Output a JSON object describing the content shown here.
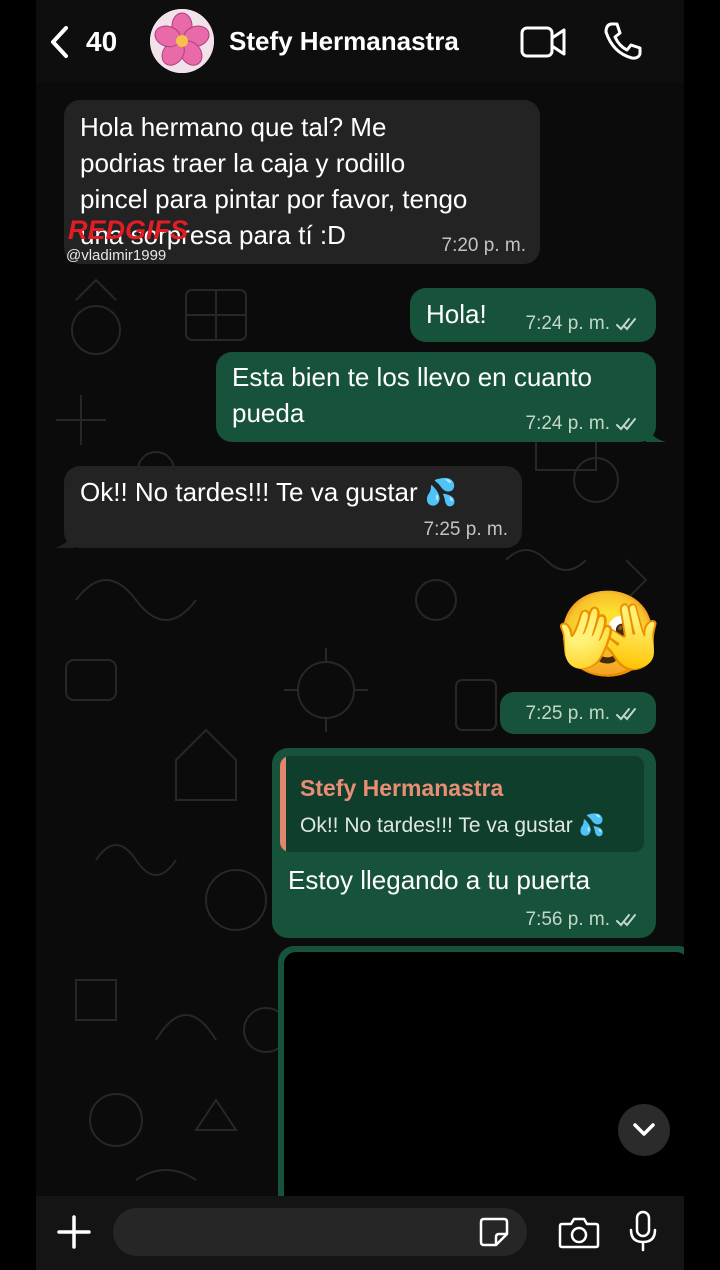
{
  "header": {
    "back_count": "40",
    "contact_name": "Stefy Hermanastra"
  },
  "watermark": {
    "logo": "REDGIFS",
    "user": "@vladimir1999"
  },
  "messages": [
    {
      "direction": "in",
      "lines": [
        "Hola hermano que tal? Me",
        "podrias traer la caja y rodillo",
        "pincel para pintar por favor, tengo",
        "una sorpresa para tí :D"
      ],
      "time": "7:20 p. m."
    },
    {
      "direction": "out",
      "text": "Hola!",
      "time": "7:24 p. m."
    },
    {
      "direction": "out",
      "lines": [
        "Esta bien te los llevo en cuanto",
        "pueda"
      ],
      "time": "7:24 p. m."
    },
    {
      "direction": "in",
      "text": "Ok!! No tardes!!! Te va gustar 💦",
      "time": "7:25 p. m."
    },
    {
      "direction": "out",
      "emoji": "🫣",
      "time": "7:25 p. m."
    },
    {
      "direction": "out",
      "reply_to_name": "Stefy Hermanastra",
      "reply_to_text": "Ok!! No tardes!!! Te va gustar 💦",
      "text": "Estoy llegando a tu puerta",
      "time": "7:56 p. m."
    }
  ],
  "composer": {
    "placeholder": ""
  },
  "colors": {
    "incoming_bubble": "#232323",
    "outgoing_bubble": "#16533a",
    "reply_accent": "#e1856b"
  },
  "icons": [
    "back-chevron-icon",
    "video-call-icon",
    "phone-icon",
    "plus-icon",
    "sticker-icon",
    "camera-icon",
    "mic-icon",
    "chevron-down-icon",
    "double-check-icon"
  ]
}
